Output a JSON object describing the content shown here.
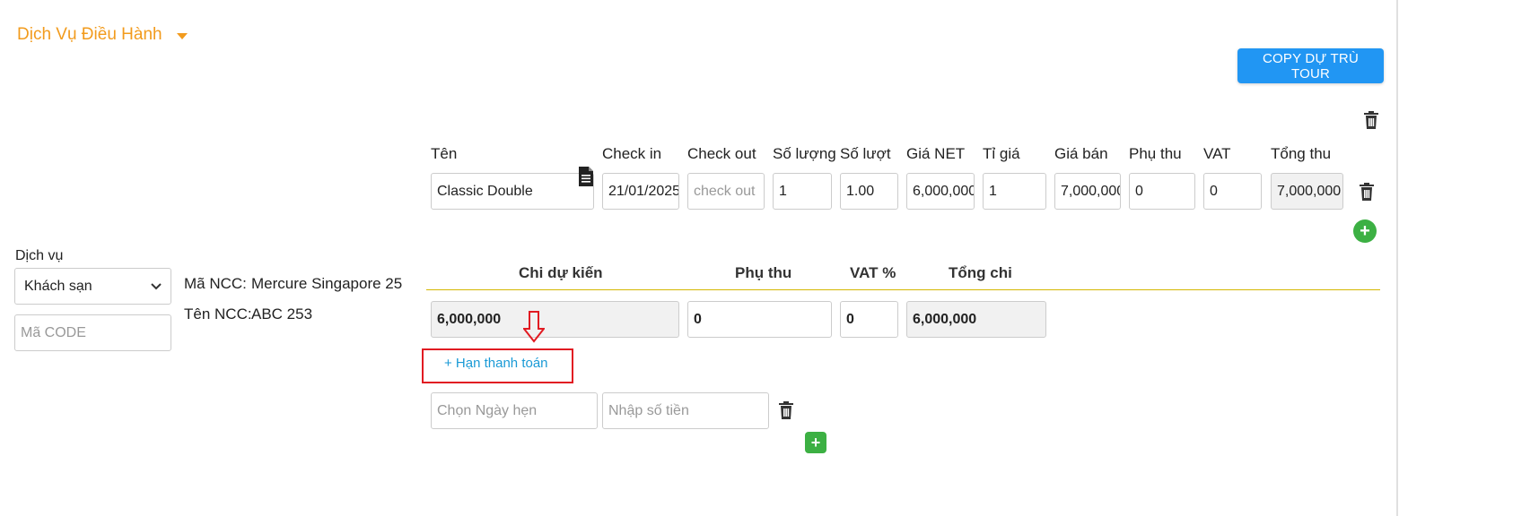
{
  "section": {
    "title": "Dịch Vụ Điều Hành"
  },
  "copy_button": "COPY DỰ TRÙ TOUR",
  "left": {
    "service_label": "Dịch vụ",
    "service_select": "Khách sạn",
    "code_placeholder": "Mã CODE",
    "ma_ncc_label": "Mã NCC:",
    "ma_ncc_value": "Mercure Singapore 25",
    "ten_ncc_label": "Tên NCC:",
    "ten_ncc_value": "ABC 253"
  },
  "table": {
    "headers": [
      "Tên",
      "Check in",
      "Check out",
      "Số lượng",
      "Số lượt",
      "Giá NET",
      "Tỉ giá",
      "Giá bán",
      "Phụ thu",
      "VAT",
      "Tổng thu"
    ],
    "row": {
      "ten": "Classic Double",
      "check_in": "21/01/2025",
      "check_out_placeholder": "check out",
      "so_luong": "1",
      "so_luot": "1.00",
      "gia_net": "6,000,000",
      "ti_gia": "1",
      "gia_ban": "7,000,000",
      "phu_thu": "0",
      "vat": "0",
      "tong_thu": "7,000,000"
    }
  },
  "summary": {
    "headers": [
      "Chi dự kiến",
      "Phụ thu",
      "VAT %",
      "Tổng chi"
    ],
    "chi_du_kien": "6,000,000",
    "phu_thu": "0",
    "vat": "0",
    "tong_chi": "6,000,000"
  },
  "payment": {
    "link": "+ Hạn thanh toán",
    "date_placeholder": "Chọn Ngày hẹn",
    "amount_placeholder": "Nhập số tiền"
  },
  "colors": {
    "accent": "#f29b1d",
    "primary": "#2196f3",
    "add": "#3cb043",
    "highlight": "#e11b22"
  }
}
